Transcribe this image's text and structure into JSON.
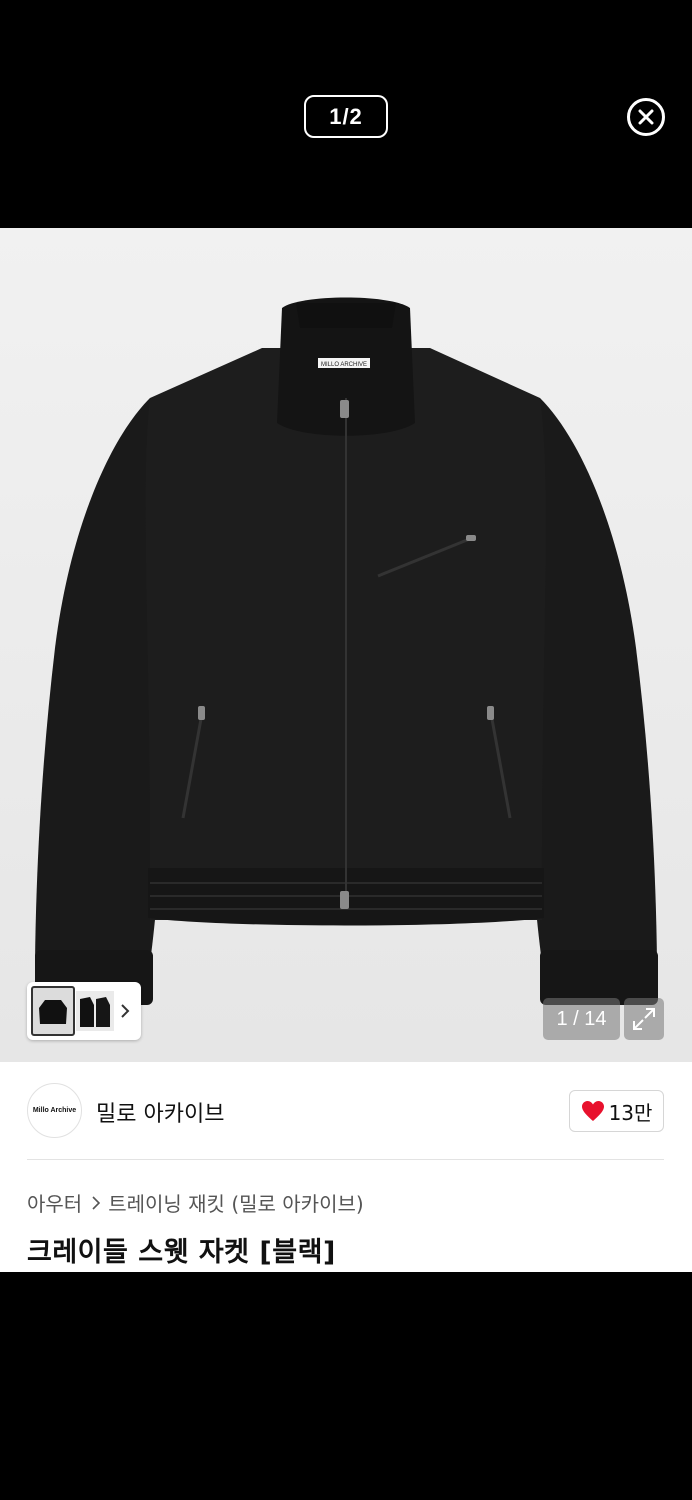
{
  "viewer": {
    "page_counter": "1/2",
    "close_icon": "close-circle-icon"
  },
  "product": {
    "image_counter": "1 / 14",
    "expand_icon": "expand-icon",
    "thumb_arrow_icon": "chevron-right-icon",
    "label_text": "MILLO ARCHIVE"
  },
  "seller": {
    "logo_text": "Millo Archive",
    "name": "밀로 아카이브",
    "like_count": "13만",
    "like_color": "#e8112d"
  },
  "breadcrumb": {
    "category": "아우터",
    "subcategory": "트레이닝 재킷 (밀로 아카이브)"
  },
  "title": "크레이들 스웻 자켓 [블랙]"
}
